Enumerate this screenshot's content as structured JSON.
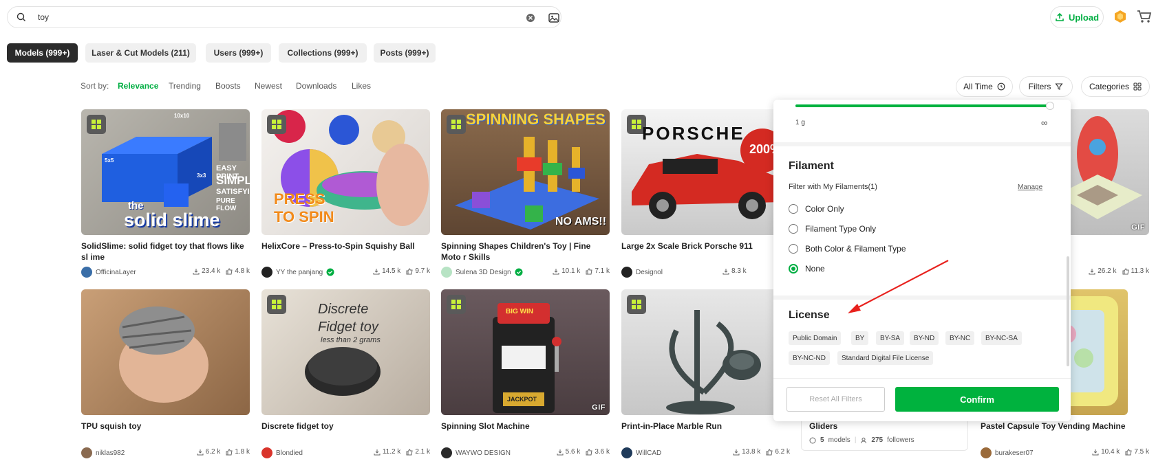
{
  "search": {
    "value": "toy"
  },
  "header": {
    "upload_label": "Upload"
  },
  "tabs": [
    {
      "label": "Models (999+)"
    },
    {
      "label": "Laser & Cut Models (211)"
    },
    {
      "label": "Users (999+)"
    },
    {
      "label": "Collections (999+)"
    },
    {
      "label": "Posts (999+)"
    }
  ],
  "sort": {
    "label": "Sort by:",
    "options": [
      "Relevance",
      "Trending",
      "Boosts",
      "Newest",
      "Downloads",
      "Likes"
    ]
  },
  "controls": {
    "time": "All Time",
    "filters": "Filters",
    "categories": "Categories"
  },
  "cards_row1": [
    {
      "title": "SolidSlime: solid fidget toy that flows like sl ime",
      "author": "OfficinaLayer",
      "downloads": "23.4 k",
      "likes": "4.8 k",
      "overlay": [
        "the",
        "solid slime",
        "EASY PRINT",
        "SIMPLE",
        "SATISFYING",
        "PURE FLOW",
        "10x10",
        "3x3",
        "5x5"
      ]
    },
    {
      "title": "HelixCore – Press-to-Spin Squishy Ball",
      "author": "YY the panjang",
      "downloads": "14.5 k",
      "likes": "9.7 k",
      "overlay": [
        "PRESS",
        "TO SPIN"
      ]
    },
    {
      "title": "Spinning Shapes Children's Toy | Fine Moto r Skills",
      "author": "Sulena 3D Design",
      "downloads": "10.1 k",
      "likes": "7.1 k",
      "overlay": [
        "SPINNING SHAPES",
        "NO AMS!!"
      ]
    },
    {
      "title": "Large 2x Scale Brick Porsche 911",
      "author": "Designol",
      "downloads": "8.3 k",
      "likes": "",
      "overlay": [
        "PORSCHE",
        "200%"
      ]
    },
    {
      "title": "",
      "author": "",
      "downloads": "26.2 k",
      "likes": "11.3 k",
      "gif": "GIF"
    }
  ],
  "cards_row2": [
    {
      "title": "TPU squish toy",
      "author": "niklas982",
      "downloads": "6.2 k",
      "likes": "1.8 k"
    },
    {
      "title": "Discrete fidget toy",
      "author": "Blondied",
      "downloads": "11.2 k",
      "likes": "2.1 k",
      "overlay": [
        "Discrete",
        "Fidget toy",
        "less than 2 grams"
      ]
    },
    {
      "title": "Spinning Slot Machine",
      "author": "WAYWO DESIGN",
      "downloads": "5.6 k",
      "likes": "3.6 k",
      "gif": "GIF",
      "overlay": [
        "BIG WIN",
        "JACKPOT"
      ]
    },
    {
      "title": "Print-in-Place Marble Run",
      "author": "WillCAD",
      "downloads": "13.8 k",
      "likes": "6.2 k"
    },
    {
      "title": "Pastel Capsule Toy Vending Machine",
      "author": "burakeser07",
      "downloads": "10.4 k",
      "likes": "7.5 k"
    }
  ],
  "collection": {
    "title": "Gliders",
    "models": "5",
    "models_label": "models",
    "followers": "275",
    "followers_label": "followers"
  },
  "filter_panel": {
    "weight": {
      "min": "1 g",
      "max": "∞",
      "range": [
        0,
        1
      ]
    },
    "filament": {
      "title": "Filament",
      "subtitle": "Filter with My Filaments(1)",
      "manage": "Manage",
      "options": [
        "Color Only",
        "Filament Type Only",
        "Both Color & Filament Type",
        "None"
      ],
      "selected": 3
    },
    "license": {
      "title": "License",
      "chips": [
        "Public Domain",
        "BY",
        "BY-SA",
        "BY-ND",
        "BY-NC",
        "BY-NC-SA",
        "BY-NC-ND",
        "Standard Digital File License"
      ]
    },
    "reset": "Reset All Filters",
    "confirm": "Confirm"
  },
  "colors": {
    "accent": "#00ae42",
    "annotation_arrow": "#e8211d"
  }
}
